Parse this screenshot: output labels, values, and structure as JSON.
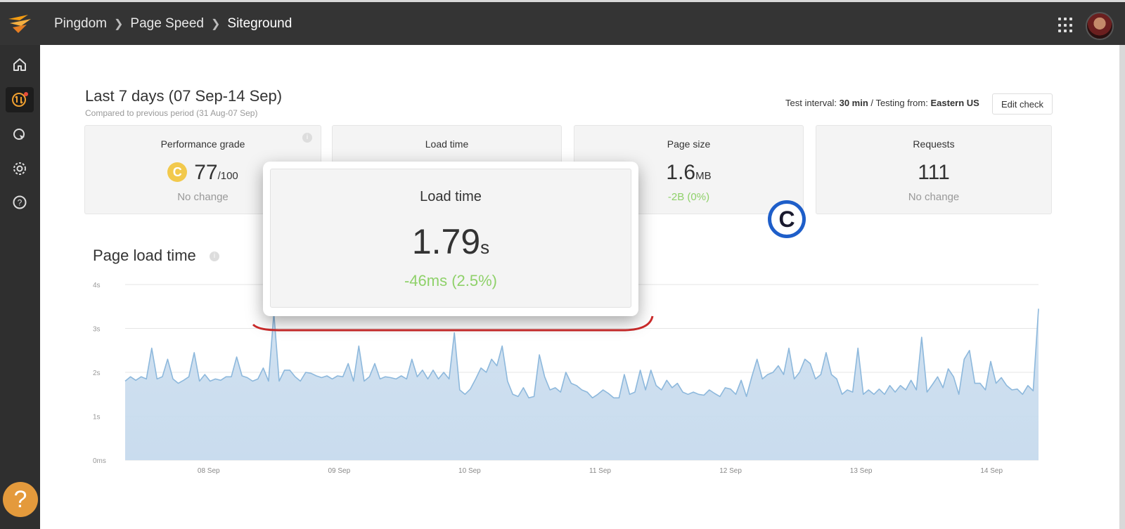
{
  "header": {
    "breadcrumb": [
      "Pingdom",
      "Page Speed",
      "Siteground"
    ]
  },
  "sidebar": {
    "items": [
      "home-icon",
      "uptime-icon",
      "pointer-icon",
      "settings-icon",
      "help-icon"
    ],
    "help_button": "?"
  },
  "period": {
    "title": "Last 7 days (07 Sep-14 Sep)",
    "subtitle": "Compared to previous period (31 Aug-07 Sep)"
  },
  "test_info": {
    "interval_label": "Test interval:",
    "interval_value": "30 min",
    "separator": "/",
    "from_label": "Testing from:",
    "from_value": "Eastern US"
  },
  "edit_button": "Edit check",
  "cards": {
    "grade": {
      "label": "Performance grade",
      "badge": "C",
      "value": "77",
      "unit": "/100",
      "change": "No change"
    },
    "load": {
      "label": "Load time"
    },
    "size": {
      "label": "Page size",
      "value": "1.6",
      "unit": "MB",
      "change": "-2B (0%)"
    },
    "requests": {
      "label": "Requests",
      "value": "111",
      "change": "No change"
    }
  },
  "popup": {
    "label": "Load time",
    "value": "1.79",
    "unit": "s",
    "change": "-46ms (2.5%)"
  },
  "overlay_badge": "C",
  "colors": {
    "accent_green": "#8fd16a",
    "grade_yellow": "#f2c94c",
    "chart_line": "#8db8dc",
    "chart_fill": "#c9dcee",
    "annotation_red": "#cc2b2b",
    "badge_blue": "#1e5ec9"
  },
  "chart_data": {
    "type": "area",
    "title": "Page load time",
    "y_ticks": [
      "0ms",
      "1s",
      "2s",
      "3s",
      "4s"
    ],
    "x_ticks": [
      "08 Sep",
      "09 Sep",
      "10 Sep",
      "11 Sep",
      "12 Sep",
      "13 Sep",
      "14 Sep"
    ],
    "ylim": [
      0,
      4
    ],
    "xlim": [
      0,
      7
    ],
    "x_unit": "days from 07 Sep",
    "y_unit": "s",
    "grid": true,
    "values": [
      1.8,
      1.9,
      1.82,
      1.9,
      1.85,
      2.55,
      1.85,
      1.9,
      2.3,
      1.85,
      1.75,
      1.82,
      1.9,
      2.45,
      1.8,
      1.95,
      1.8,
      1.85,
      1.82,
      1.9,
      1.9,
      2.35,
      1.92,
      1.88,
      1.8,
      1.85,
      2.1,
      1.8,
      3.35,
      1.8,
      2.05,
      2.05,
      1.9,
      1.8,
      2.0,
      1.98,
      1.92,
      1.88,
      1.92,
      1.85,
      1.92,
      1.9,
      2.2,
      1.8,
      2.6,
      1.8,
      1.9,
      2.2,
      1.85,
      1.9,
      1.88,
      1.85,
      1.92,
      1.85,
      2.3,
      1.9,
      2.05,
      1.85,
      2.05,
      1.85,
      2.0,
      1.85,
      2.9,
      1.6,
      1.5,
      1.62,
      1.85,
      2.1,
      2.0,
      2.3,
      2.15,
      2.6,
      1.8,
      1.5,
      1.45,
      1.65,
      1.42,
      1.45,
      2.4,
      1.9,
      1.6,
      1.65,
      1.55,
      2.0,
      1.75,
      1.7,
      1.6,
      1.55,
      1.42,
      1.5,
      1.6,
      1.52,
      1.42,
      1.42,
      1.95,
      1.5,
      1.55,
      2.05,
      1.6,
      2.05,
      1.7,
      1.6,
      1.82,
      1.65,
      1.75,
      1.55,
      1.5,
      1.55,
      1.5,
      1.48,
      1.6,
      1.52,
      1.45,
      1.65,
      1.62,
      1.5,
      1.82,
      1.45,
      1.9,
      2.3,
      1.85,
      1.95,
      2.0,
      2.15,
      1.95,
      2.55,
      1.85,
      2.0,
      2.3,
      2.2,
      1.85,
      1.95,
      2.45,
      1.95,
      1.85,
      1.5,
      1.6,
      1.55,
      2.55,
      1.5,
      1.6,
      1.5,
      1.62,
      1.5,
      1.7,
      1.55,
      1.7,
      1.6,
      1.82,
      1.6,
      2.8,
      1.55,
      1.72,
      1.9,
      1.65,
      2.08,
      1.9,
      1.5,
      2.3,
      2.5,
      1.75,
      1.75,
      1.6,
      2.25,
      1.75,
      1.88,
      1.7,
      1.6,
      1.62,
      1.5,
      1.7,
      1.58,
      3.45
    ]
  }
}
